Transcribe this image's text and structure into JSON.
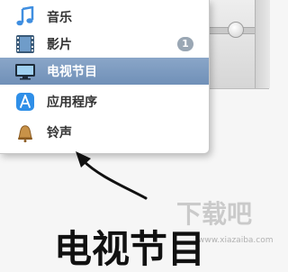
{
  "menu": {
    "items": [
      {
        "label": "音乐",
        "icon": "music-note-icon",
        "selected": false
      },
      {
        "label": "影片",
        "icon": "film-strip-icon",
        "selected": false,
        "badge": "1"
      },
      {
        "label": "电视节目",
        "icon": "tv-monitor-icon",
        "selected": true
      },
      {
        "label": "应用程序",
        "icon": "app-store-icon",
        "selected": false
      },
      {
        "label": "铃声",
        "icon": "bell-icon",
        "selected": false
      }
    ]
  },
  "bottom_title": "电视节目",
  "watermark": {
    "text": "下载吧",
    "url": "www.xiazaiba.com"
  },
  "colors": {
    "selected_bg": "#7f9cc2",
    "badge_bg": "#9aa7b4",
    "music_icon": "#3f8ee0"
  }
}
